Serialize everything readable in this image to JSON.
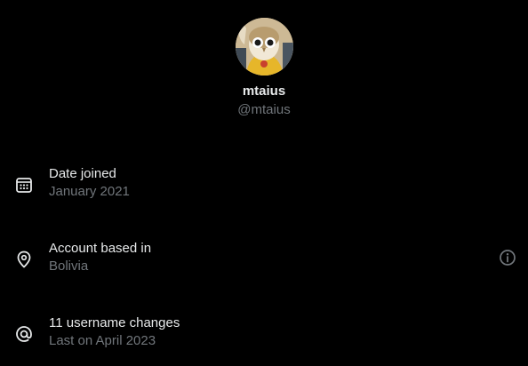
{
  "profile": {
    "display_name": "mtaius",
    "handle": "@mtaius"
  },
  "rows": [
    {
      "icon": "calendar-icon",
      "title": "Date joined",
      "subtitle": "January 2021"
    },
    {
      "icon": "location-pin-icon",
      "title": "Account based in",
      "subtitle": "Bolivia"
    },
    {
      "icon": "at-sign-icon",
      "title": "11 username changes",
      "subtitle": "Last on April 2023"
    }
  ],
  "actions": {
    "info_icon": "info-icon"
  },
  "colors": {
    "background": "#000000",
    "primary_text": "#e7e9ea",
    "secondary_text": "#71767b"
  }
}
